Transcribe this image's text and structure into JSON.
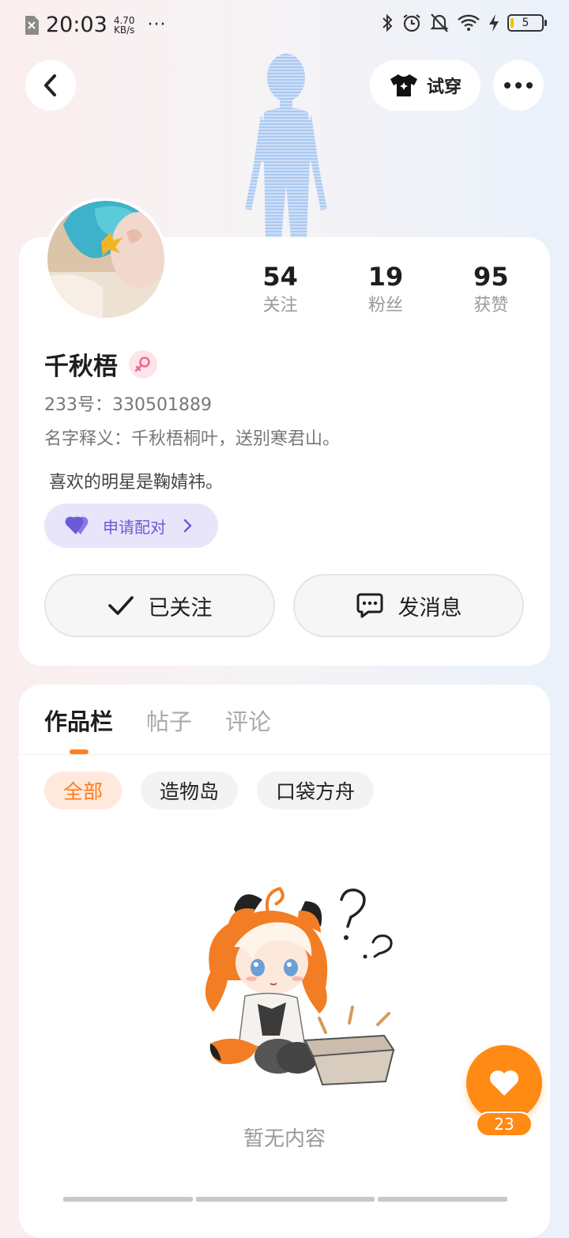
{
  "status_bar": {
    "time": "20:03",
    "net_speed_value": "4.70",
    "net_speed_unit": "KB/s",
    "more": "···",
    "battery_level": "5"
  },
  "header": {
    "tryon_label": "试穿"
  },
  "profile": {
    "name": "千秋梧",
    "uid": "233号：330501889",
    "name_meaning": "名字释义：千秋梧桐叶，送别寒君山。",
    "bio": "喜欢的明星是鞠婧祎。",
    "pair_label": "申请配对",
    "stats": [
      {
        "num": "54",
        "label": "关注"
      },
      {
        "num": "19",
        "label": "粉丝"
      },
      {
        "num": "95",
        "label": "获赞"
      }
    ],
    "follow_label": "已关注",
    "message_label": "发消息"
  },
  "content": {
    "tabs": [
      {
        "label": "作品栏",
        "active": true
      },
      {
        "label": "帖子",
        "active": false
      },
      {
        "label": "评论",
        "active": false
      }
    ],
    "chips": [
      {
        "label": "全部",
        "active": true
      },
      {
        "label": "造物岛",
        "active": false
      },
      {
        "label": "口袋方舟",
        "active": false
      }
    ],
    "empty_text": "暂无内容"
  },
  "like": {
    "count": "23"
  },
  "colors": {
    "accent": "#ff8a14",
    "pair_purple": "#6a5bd6"
  }
}
